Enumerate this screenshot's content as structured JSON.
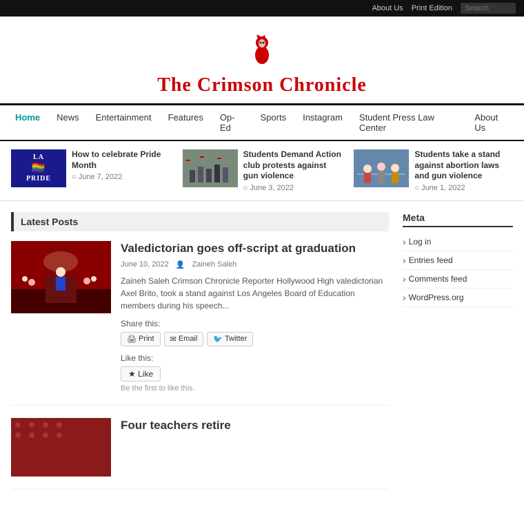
{
  "topbar": {
    "about_us": "About Us",
    "print_edition": "Print Edition",
    "search_placeholder": "Search"
  },
  "header": {
    "title": "The Crimson Chronicle"
  },
  "nav": {
    "items": [
      {
        "label": "Home",
        "active": true
      },
      {
        "label": "News",
        "active": false
      },
      {
        "label": "Entertainment",
        "active": false
      },
      {
        "label": "Features",
        "active": false
      },
      {
        "label": "Op-Ed",
        "active": false
      },
      {
        "label": "Sports",
        "active": false
      },
      {
        "label": "Instagram",
        "active": false
      },
      {
        "label": "Student Press Law Center",
        "active": false
      },
      {
        "label": "About Us",
        "active": false
      }
    ]
  },
  "featured": [
    {
      "thumb_type": "lapride",
      "title": "How to celebrate Pride Month",
      "date": "June 7, 2022"
    },
    {
      "thumb_type": "protest",
      "title": "Students Demand Action club protests against gun violence",
      "date": "June 3, 2022"
    },
    {
      "thumb_type": "abortion",
      "title": "Students take a stand against abortion laws and gun violence",
      "date": "June 1, 2022"
    }
  ],
  "latest_posts_heading": "Latest Posts",
  "posts": [
    {
      "title": "Valedictorian goes off-script at graduation",
      "date": "June 10, 2022",
      "author": "Zaineh Saleh",
      "excerpt": "Zaineh Saleh Crimson Chronicle Reporter Hollywood High valedictorian Axel Brito, took a stand against Los Angeles Board of Education members during his speech...",
      "thumb_type": "graduation"
    },
    {
      "title": "Four teachers retire",
      "thumb_type": "teachers"
    }
  ],
  "share": {
    "label": "Share this:",
    "buttons": [
      {
        "label": "Print",
        "icon": "🖨"
      },
      {
        "label": "Email",
        "icon": "✉"
      },
      {
        "label": "Twitter",
        "icon": "🐦"
      }
    ]
  },
  "like": {
    "label": "Like this:",
    "button": "Like",
    "note": "Be the first to like this."
  },
  "meta": {
    "title": "Meta",
    "links": [
      "Log in",
      "Entries feed",
      "Comments feed",
      "WordPress.org"
    ]
  }
}
